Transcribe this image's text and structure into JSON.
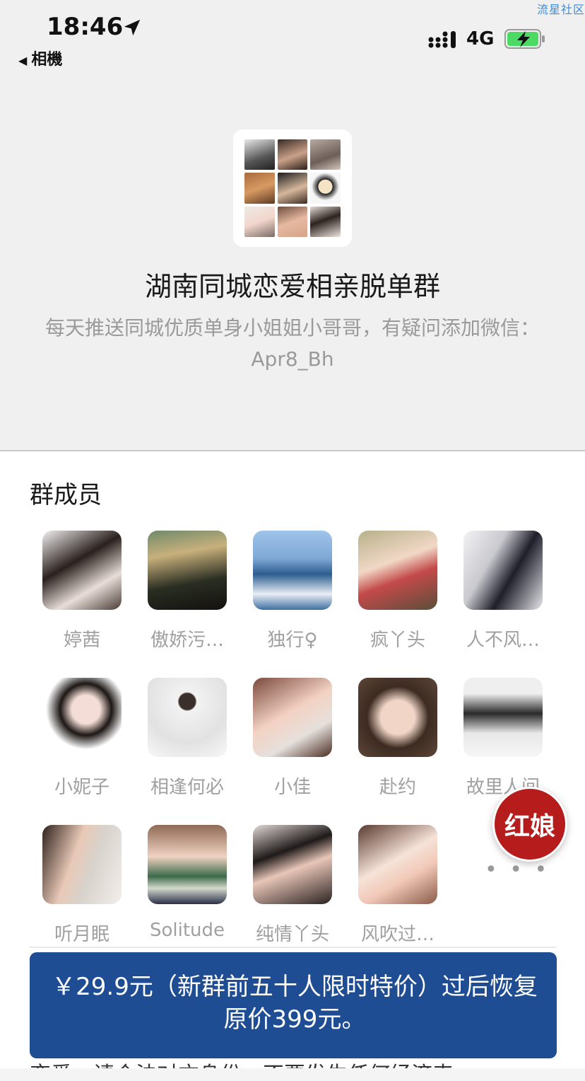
{
  "watermark": "流星社区",
  "status": {
    "time": "18:46",
    "back_app": "相機",
    "network": "4G"
  },
  "group": {
    "name": "湖南同城恋爱相亲脱单群",
    "description": "每天推送同城优质单身小姐姐小哥哥，有疑问添加微信：Apr8_Bh"
  },
  "members_section": {
    "title": "群成员",
    "members": [
      {
        "name": "婷茜"
      },
      {
        "name": "傲娇污…"
      },
      {
        "name": "独行♀"
      },
      {
        "name": "疯丫头"
      },
      {
        "name": "人不风…"
      },
      {
        "name": "小妮子"
      },
      {
        "name": "相逢何必"
      },
      {
        "name": "小佳"
      },
      {
        "name": "赴约"
      },
      {
        "name": "故里人间"
      },
      {
        "name": "听月眠"
      },
      {
        "name": "Solitude"
      },
      {
        "name": "纯情丫头"
      },
      {
        "name": "风吹过…"
      }
    ],
    "more": "• • •"
  },
  "hongniang_button": "红娘",
  "price_banner": "￥29.9元（新群前五十人限时特价）过后恢复原价399元。",
  "bottom_text": "恋爱，请合法对方身份，不要发生任何经济来"
}
